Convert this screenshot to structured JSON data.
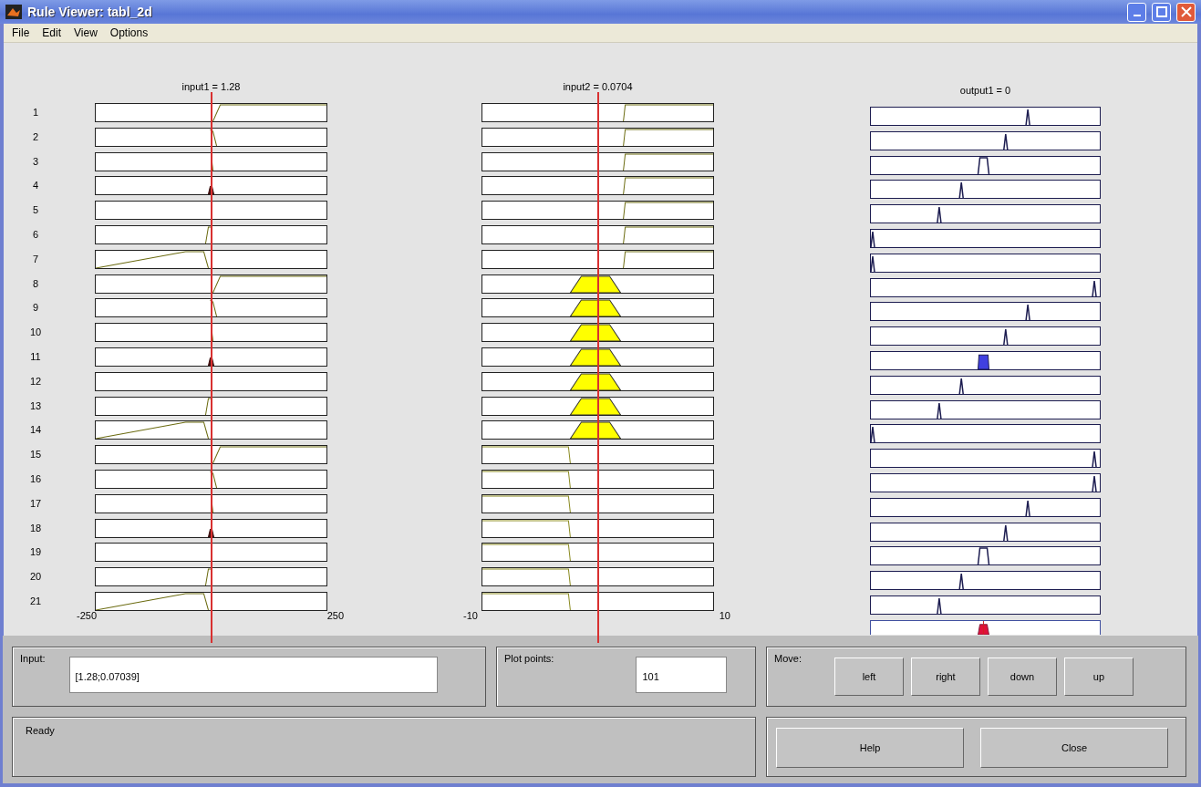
{
  "window": {
    "title": "Rule Viewer: tabl_2d"
  },
  "menu": [
    "File",
    "Edit",
    "View",
    "Options"
  ],
  "plots": [
    {
      "kind": "input",
      "title": "input1 = 1.28",
      "xticks": [
        "-250",
        "250"
      ]
    },
    {
      "kind": "input",
      "title": "input2 = 0.0704",
      "xticks": [
        "-10",
        "10"
      ]
    },
    {
      "kind": "output",
      "title": "output1 = 0"
    }
  ],
  "rule_numbers": [
    "1",
    "2",
    "3",
    "4",
    "5",
    "6",
    "7",
    "8",
    "9",
    "10",
    "11",
    "12",
    "13",
    "14",
    "15",
    "16",
    "17",
    "18",
    "19",
    "20",
    "21"
  ],
  "input_panel": {
    "label": "Input:",
    "value": "[1.28;0.07039]"
  },
  "plot_points": {
    "label": "Plot points:",
    "value": "101"
  },
  "move": {
    "label": "Move:",
    "buttons": [
      "left",
      "right",
      "down",
      "up"
    ]
  },
  "status": "Ready",
  "buttons": [
    "Help",
    "Close"
  ]
}
